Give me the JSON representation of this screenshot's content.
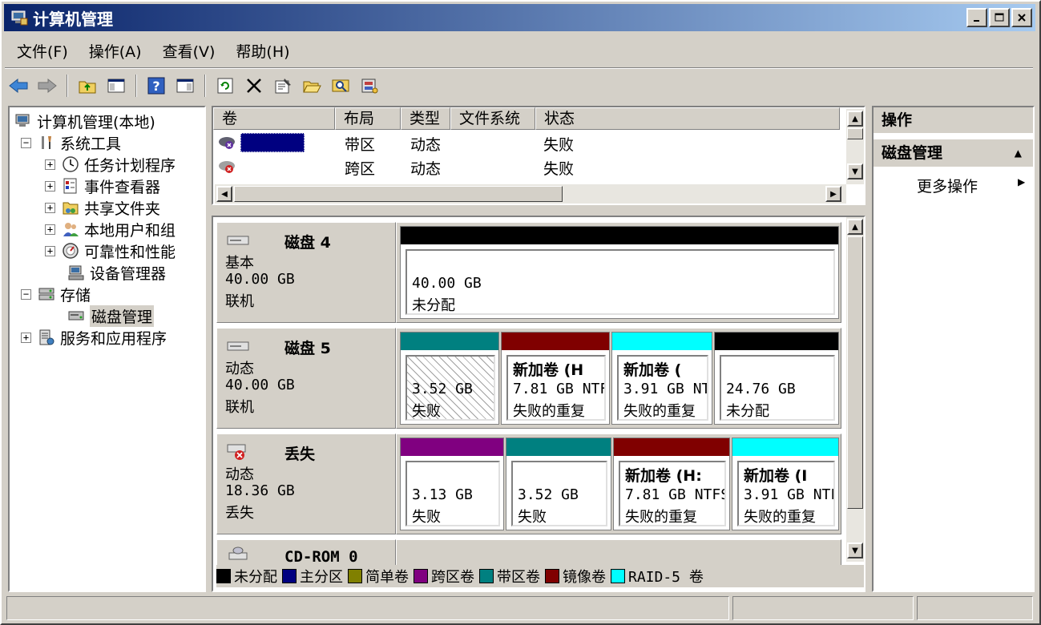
{
  "window": {
    "title": "计算机管理"
  },
  "menu": {
    "items": [
      "文件(F)",
      "操作(A)",
      "查看(V)",
      "帮助(H)"
    ]
  },
  "tree": {
    "root": "计算机管理(本地)",
    "system_tools": "系统工具",
    "task_scheduler": "任务计划程序",
    "event_viewer": "事件查看器",
    "shared_folders": "共享文件夹",
    "local_users": "本地用户和组",
    "reliability": "可靠性和性能",
    "device_manager": "设备管理器",
    "storage": "存储",
    "disk_management": "磁盘管理",
    "services_apps": "服务和应用程序"
  },
  "volume_list": {
    "columns": [
      "卷",
      "布局",
      "类型",
      "文件系统",
      "状态"
    ],
    "rows": [
      {
        "volume": "",
        "layout": "带区",
        "type": "动态",
        "fs": "",
        "status": "失败"
      },
      {
        "volume": "",
        "layout": "跨区",
        "type": "动态",
        "fs": "",
        "status": "失败"
      }
    ]
  },
  "disks": {
    "disk4": {
      "name": "磁盘 4",
      "kind": "基本",
      "size": "40.00 GB",
      "state": "联机",
      "partitions": [
        {
          "size": "40.00 GB",
          "status": "未分配"
        }
      ]
    },
    "disk5": {
      "name": "磁盘 5",
      "kind": "动态",
      "size": "40.00 GB",
      "state": "联机",
      "partitions": [
        {
          "label": "",
          "size": "3.52 GB",
          "status": "失败"
        },
        {
          "label": "新加卷  (H",
          "size": "7.81 GB NTF",
          "status": "失败的重复"
        },
        {
          "label": "新加卷  (",
          "size": "3.91 GB NT",
          "status": "失败的重复"
        },
        {
          "label": "",
          "size": "24.76 GB",
          "status": "未分配"
        }
      ]
    },
    "missing": {
      "name": "丢失",
      "kind": "动态",
      "size": "18.36 GB",
      "state": "丢失",
      "partitions": [
        {
          "label": "",
          "size": "3.13 GB",
          "status": "失败"
        },
        {
          "label": "",
          "size": "3.52 GB",
          "status": "失败"
        },
        {
          "label": "新加卷  (H:",
          "size": "7.81 GB NTFS",
          "status": "失败的重复"
        },
        {
          "label": "新加卷  (I",
          "size": "3.91 GB NTF",
          "status": "失败的重复"
        }
      ]
    },
    "cdrom": {
      "name": "CD-ROM 0"
    }
  },
  "legend": [
    "未分配",
    "主分区",
    "简单卷",
    "跨区卷",
    "带区卷",
    "镜像卷",
    "RAID-5 卷"
  ],
  "legend_colors": [
    "#000000",
    "#000080",
    "#808000",
    "#800080",
    "#008080",
    "#800000",
    "#00ffff"
  ],
  "actions": {
    "header": "操作",
    "section": "磁盘管理",
    "more": "更多操作"
  }
}
